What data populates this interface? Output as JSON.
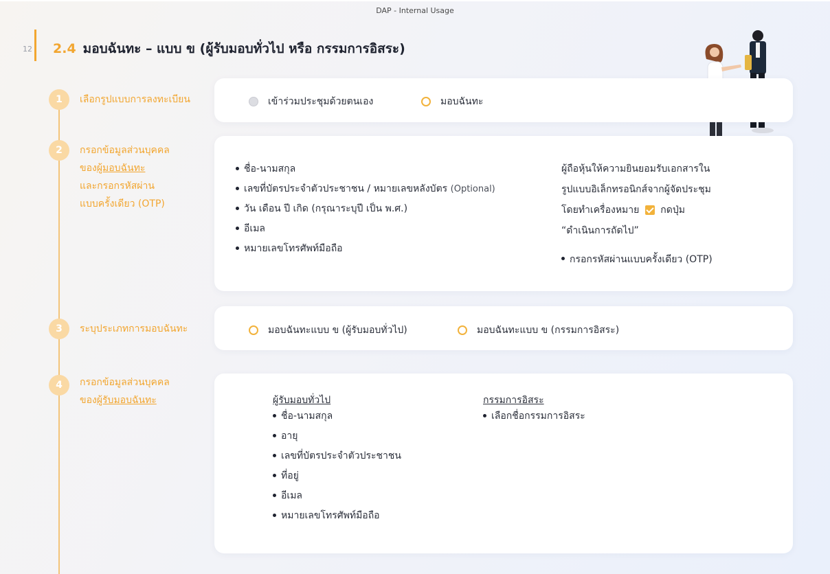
{
  "header_note": "DAP - Internal Usage",
  "page_number": "12",
  "title": {
    "number": "2.4",
    "text": "มอบฉันทะ – แบบ ข  (ผู้รับมอบทั่วไป หรือ กรรมการอิสระ)"
  },
  "steps": [
    {
      "num": "1",
      "label_line1": "เลือกรูปแบบการลงทะเบียน"
    },
    {
      "num": "2",
      "label_line1": "กรอกข้อมูลส่วนบุคคล",
      "label_line2_prefix": "ของ",
      "label_line2_link": "ผู้มอบฉันทะ",
      "label_line3": "และกรอกรหัสผ่าน",
      "label_line4": "แบบครั้งเดียว (OTP)"
    },
    {
      "num": "3",
      "label_line1": "ระบุประเภทการมอบฉันทะ"
    },
    {
      "num": "4",
      "label_line1": "กรอกข้อมูลส่วนบุคคล",
      "label_line2_prefix": "ของ",
      "label_line2_link": "ผู้รับมอบฉันทะ"
    }
  ],
  "step1_options": [
    {
      "label": "เข้าร่วมประชุมด้วยตนเอง",
      "style": "gray"
    },
    {
      "label": "มอบฉันทะ",
      "style": "orange"
    }
  ],
  "step2_fields": [
    {
      "text": "ชื่อ-นามสกุล"
    },
    {
      "text": "เลขที่บัตรประจำตัวประชาชน / หมายเลขหลังบัตร",
      "suffix": "(Optional)"
    },
    {
      "text": "วัน เดือน ปี เกิด (กรุณาระบุปี เป็น พ.ศ.)"
    },
    {
      "text": "อีเมล"
    },
    {
      "text": "หมายเลขโทรศัพท์มือถือ"
    }
  ],
  "step2_consent": {
    "line1": "ผู้ถือหุ้นให้ความยินยอมรับเอกสารใน",
    "line2": "รูปแบบอิเล็กทรอนิกส์จากผู้จัดประชุม",
    "line3_prefix": "โดยทำเครื่องหมาย",
    "line3_suffix": "กดปุ่ม",
    "line4": "“ดำเนินการถัดไป”",
    "otp_bullet": "กรอกรหัสผ่านแบบครั้งเดียว (OTP)"
  },
  "step3_options": [
    {
      "label": "มอบฉันทะแบบ ข (ผู้รับมอบทั่วไป)"
    },
    {
      "label": "มอบฉันทะแบบ ข (กรรมการอิสระ)"
    }
  ],
  "step4": {
    "general_heading": "ผู้รับมอบทั่วไป",
    "general_fields": [
      "ชื่อ-นามสกุล",
      "อายุ",
      "เลขที่บัตรประจำตัวประชาชน",
      "ที่อยู่",
      "อีเมล",
      "หมายเลขโทรศัพท์มือถือ"
    ],
    "director_heading": "กรรมการอิสระ",
    "director_fields": [
      "เลือกชื่อกรรมการอิสระ"
    ]
  },
  "colors": {
    "accent": "#f2a630",
    "step_circle": "#fad9a4",
    "timeline": "#f3c47a"
  }
}
